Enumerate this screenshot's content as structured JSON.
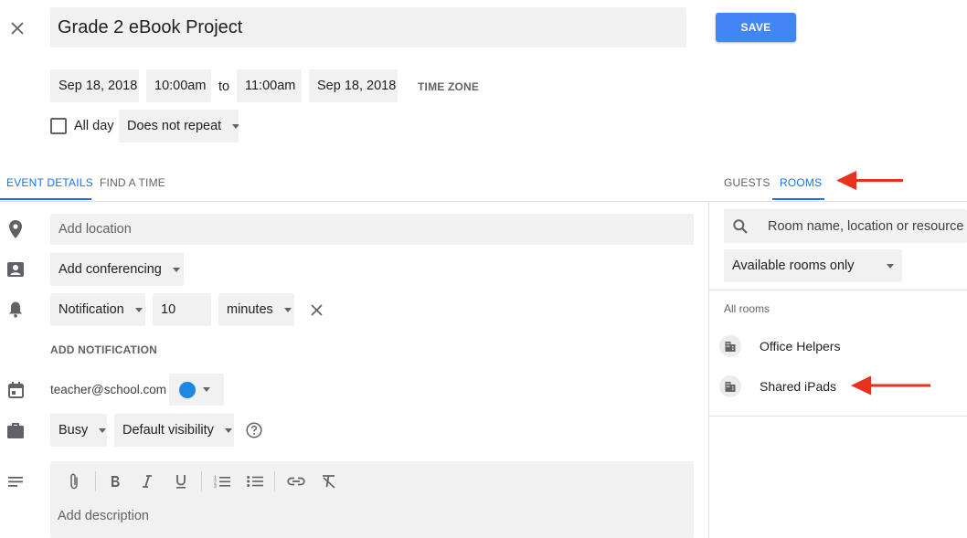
{
  "title": "Grade 2 eBook Project",
  "save_label": "SAVE",
  "time": {
    "start_date": "Sep 18, 2018",
    "start_time": "10:00am",
    "to_label": "to",
    "end_time": "11:00am",
    "end_date": "Sep 18, 2018",
    "time_zone_label": "TIME ZONE"
  },
  "all_day_label": "All day",
  "repeat_value": "Does not repeat",
  "tabs": {
    "event_details": "EVENT DETAILS",
    "find_a_time": "FIND A TIME",
    "guests": "GUESTS",
    "rooms": "ROOMS"
  },
  "location_placeholder": "Add location",
  "conferencing_value": "Add conferencing",
  "notification": {
    "type": "Notification",
    "amount": "10",
    "unit": "minutes",
    "add_label": "ADD NOTIFICATION"
  },
  "calendar_owner": "teacher@school.com",
  "calendar_color": "#1e88e5",
  "availability_value": "Busy",
  "visibility_value": "Default visibility",
  "description_placeholder": "Add description",
  "rooms": {
    "search_placeholder": "Room name, location or resource",
    "filter_value": "Available rooms only",
    "section_label": "All rooms",
    "items": [
      {
        "label": "Office Helpers"
      },
      {
        "label": "Shared iPads"
      }
    ]
  },
  "colors": {
    "accent": "#1a73e8",
    "save_button": "#4285f4",
    "annotation_arrow": "#e8321d"
  }
}
